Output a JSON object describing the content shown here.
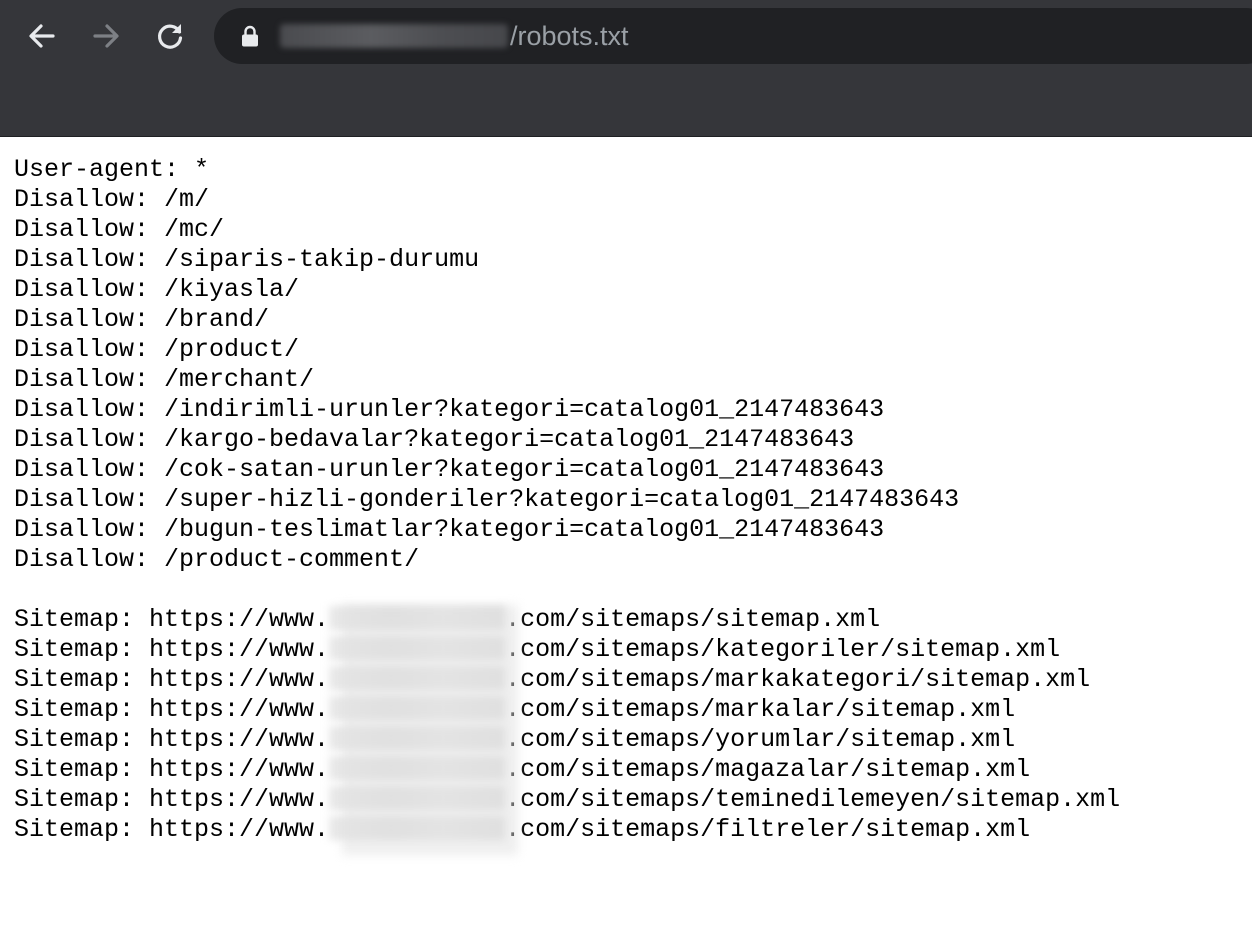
{
  "browser": {
    "back_icon": "arrow-left-icon",
    "forward_icon": "arrow-right-icon",
    "reload_icon": "reload-icon",
    "lock_icon": "lock-icon",
    "url_path": "/robots.txt",
    "colors": {
      "toolbar_bg": "#35363a",
      "omnibox_bg": "#202124",
      "icon_active": "#e8eaed",
      "icon_disabled": "#7d8085",
      "url_text": "#9aa0a6"
    }
  },
  "robots": {
    "user_agent_line": "User-agent: *",
    "disallow": [
      "Disallow: /m/",
      "Disallow: /mc/",
      "Disallow: /siparis-takip-durumu",
      "Disallow: /kiyasla/",
      "Disallow: /brand/",
      "Disallow: /product/",
      "Disallow: /merchant/",
      "Disallow: /indirimli-urunler?kategori=catalog01_2147483643",
      "Disallow: /kargo-bedavalar?kategori=catalog01_2147483643",
      "Disallow: /cok-satan-urunler?kategori=catalog01_2147483643",
      "Disallow: /super-hizli-gonderiler?kategori=catalog01_2147483643",
      "Disallow: /bugun-teslimatlar?kategori=catalog01_2147483643",
      "Disallow: /product-comment/"
    ],
    "sitemap_prefix": "Sitemap: https://www.",
    "sitemap_suffixes": [
      ".com/sitemaps/sitemap.xml",
      ".com/sitemaps/kategoriler/sitemap.xml",
      ".com/sitemaps/markakategori/sitemap.xml",
      ".com/sitemaps/markalar/sitemap.xml",
      ".com/sitemaps/yorumlar/sitemap.xml",
      ".com/sitemaps/magazalar/sitemap.xml",
      ".com/sitemaps/teminedilemeyen/sitemap.xml",
      ".com/sitemaps/filtreler/sitemap.xml"
    ]
  }
}
